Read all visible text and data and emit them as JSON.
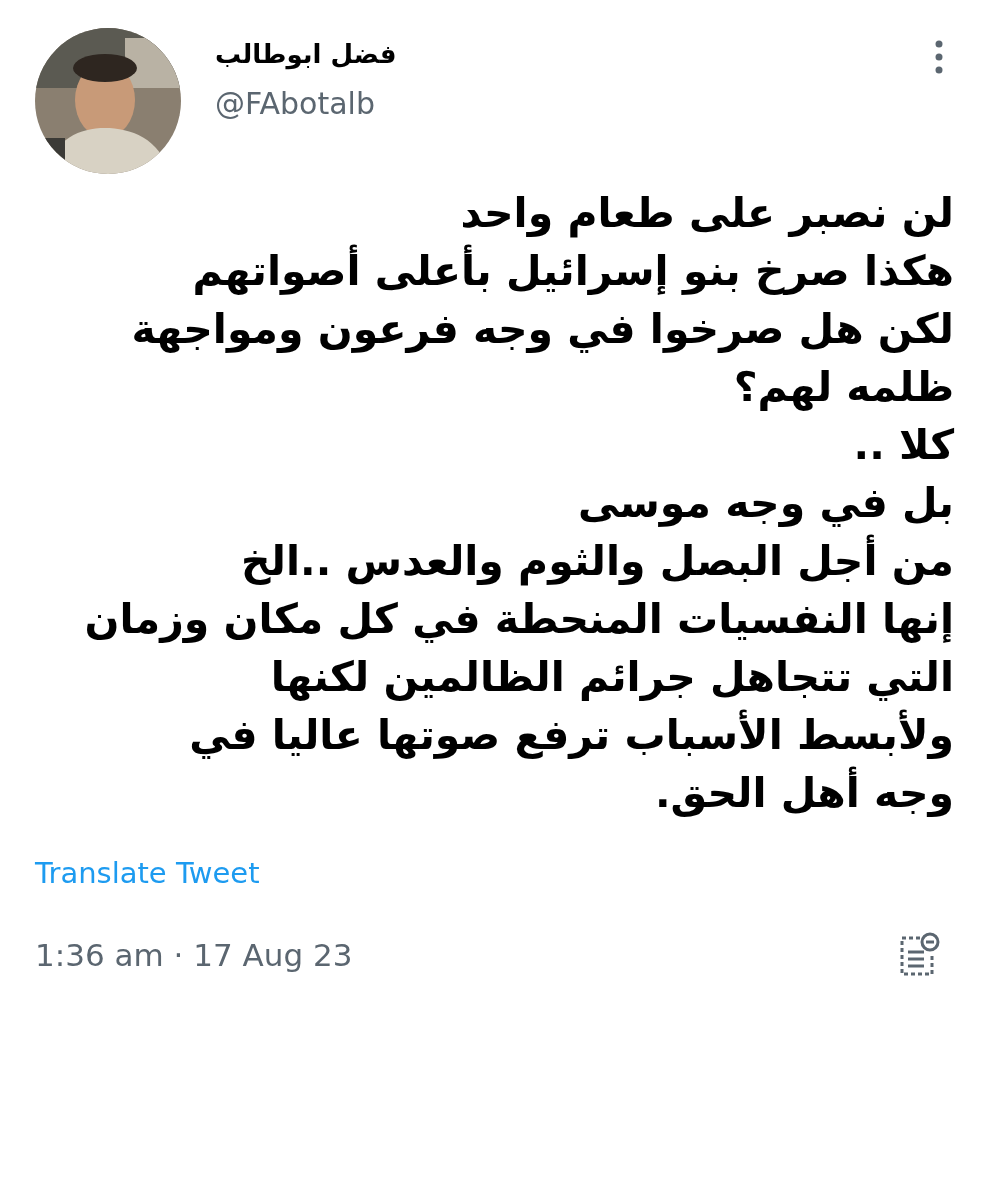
{
  "author": {
    "name": "فضل ابوطالب",
    "handle": "@FAbotalb"
  },
  "tweet_lines": [
    "لن نصبر على طعام واحد",
    "هكذا صرخ بنو إسرائيل بأعلى أصواتهم",
    "لكن هل صرخوا في وجه فرعون ومواجهة",
    "ظلمه لهم؟",
    "كلا ..",
    "بل في وجه موسى",
    "من أجل البصل والثوم والعدس ..الخ",
    "إنها النفسيات المنحطة في كل مكان وزمان",
    "التي تتجاهل جرائم الظالمين لكنها",
    "ولأبسط الأسباب ترفع صوتها عاليا في",
    "وجه أهل الحق."
  ],
  "translate_link": "Translate Tweet",
  "timestamp": "1:36 am · 17 Aug 23"
}
